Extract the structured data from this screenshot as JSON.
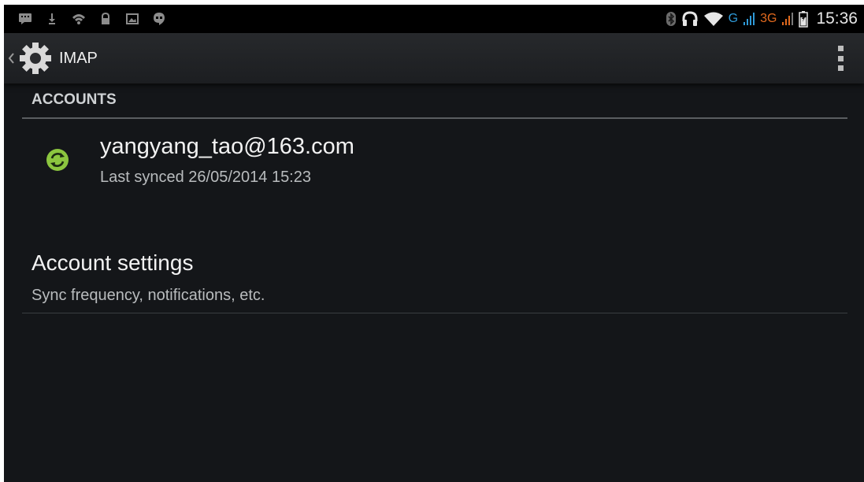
{
  "status_bar": {
    "left_icons": [
      "message-notification-icon",
      "download-icon",
      "wifi-notification-icon",
      "lock-icon",
      "image-icon",
      "hangouts-icon"
    ],
    "right_icons": [
      "bluetooth-icon",
      "headset-icon",
      "wifi-icon",
      "signal-icon",
      "battery-icon"
    ],
    "network_g": "G",
    "network_3g": "3G",
    "time": "15:36"
  },
  "action_bar": {
    "title": "IMAP"
  },
  "accounts_section": {
    "header": "ACCOUNTS",
    "account": {
      "email": "yangyang_tao@163.com",
      "last_synced": "Last synced 26/05/2014 15:23"
    }
  },
  "settings": {
    "title": "Account settings",
    "summary": "Sync frequency, notifications, etc."
  },
  "colors": {
    "background": "#141619",
    "sync_green": "#8cc63f",
    "network_blue": "#2f9ad8",
    "network_orange": "#e36a1e"
  }
}
